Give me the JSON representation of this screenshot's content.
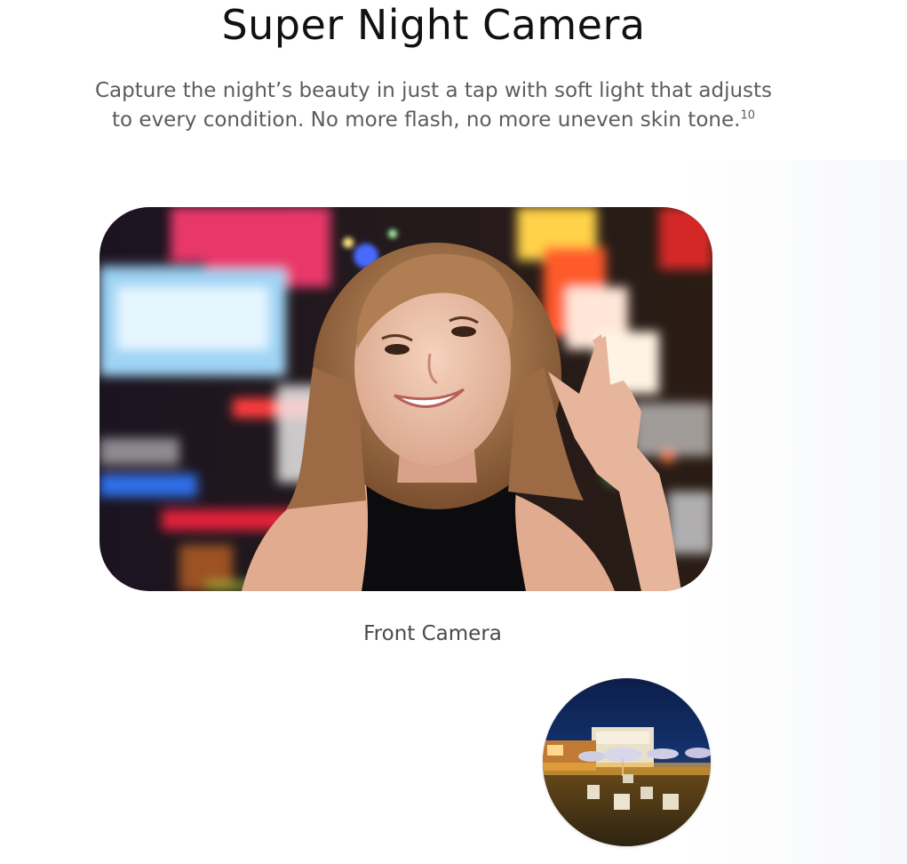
{
  "header": {
    "title": "Super Night Camera",
    "subtitle_line1": "Capture the night’s beauty in just a tap with soft light that adjusts",
    "subtitle_line2": "to every condition. No more flash, no more uneven skin tone.",
    "footnote": "10"
  },
  "hero": {
    "caption": "Front Camera",
    "image_subject": "night-selfie-photo"
  },
  "thumbnails": [
    {
      "image_subject": "night-outdoor-scene-thumbnail"
    }
  ],
  "colors": {
    "title": "#111111",
    "body_text": "#5c5c5c",
    "caption": "#4a4a4a",
    "background": "#ffffff"
  }
}
